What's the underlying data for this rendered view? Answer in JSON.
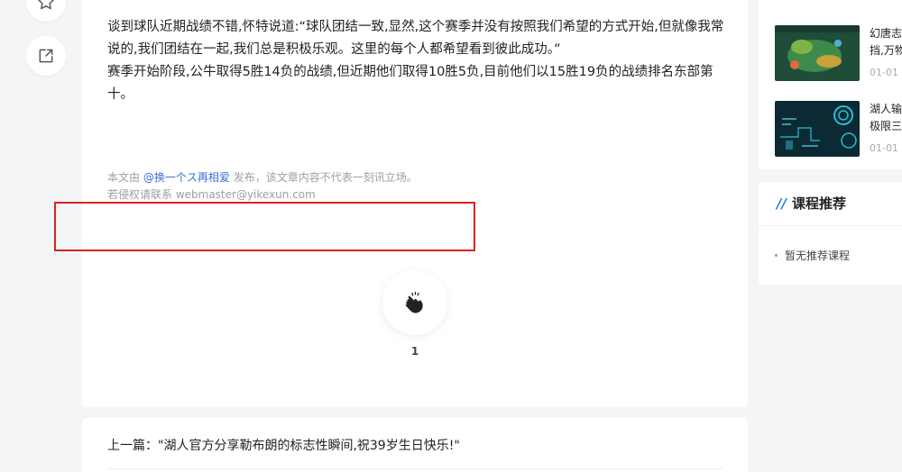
{
  "article": {
    "paragraphs": [
      "谈到球队近期战绩不错,怀特说道:“球队团结一致,显然,这个赛季并没有按照我们希望的方式开始,但就像我常说的,我们团结在一起,我们总是积极乐观。这里的每个人都希望看到彼此成功。”",
      "赛季开始阶段,公牛取得5胜14负的战绩,但近期他们取得10胜5负,目前他们以15胜19负的战绩排名东部第十。"
    ],
    "disclaimer": {
      "prefix": "本文由",
      "author": "@换一个ス再相爱",
      "suffix": "发布，该文章内容不代表一刻讯立场。",
      "contact": "若侵权请联系 webmaster@yikexun.com"
    },
    "clap_count": "1"
  },
  "prev": {
    "label": "上一篇：",
    "title": "\"湖人官方分享勒布朗的标志性瞬间,祝39岁生日快乐!\""
  },
  "sidebar": {
    "hot_items": [
      {
        "title_line1": "幻唐志",
        "title_line2": "挡,万物",
        "date": "01-01 1"
      },
      {
        "title_line1": "湖人输",
        "title_line2": "极限三",
        "date": "01-01 1"
      }
    ],
    "course": {
      "heading_mark": "//",
      "heading": "课程推荐",
      "empty_text": "暂无推荐课程"
    }
  },
  "icons": {
    "star": "star-icon",
    "share": "share-icon",
    "clap": "clap-icon"
  },
  "colors": {
    "link": "#3a6fd8",
    "accent": "#2a7ae2",
    "highlight_box": "#e02020"
  }
}
